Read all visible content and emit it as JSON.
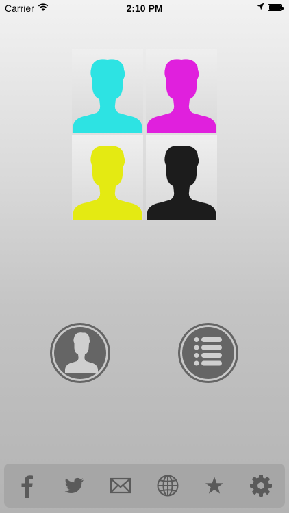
{
  "status_bar": {
    "carrier": "Carrier",
    "time": "2:10 PM",
    "wifi_icon": "wifi-icon",
    "location_icon": "location-arrow-icon",
    "battery_icon": "battery-icon",
    "battery_level": 1.0
  },
  "photo_grid": {
    "tiles": [
      {
        "name": "cyan-silhouette",
        "color": "#2de3e3"
      },
      {
        "name": "magenta-silhouette",
        "color": "#e020dd"
      },
      {
        "name": "yellow-silhouette",
        "color": "#e4ea12"
      },
      {
        "name": "black-silhouette",
        "color": "#1c1c1c"
      }
    ]
  },
  "actions": {
    "profile_button_icon": "person-icon",
    "list_button_icon": "list-icon"
  },
  "toolbar": {
    "items": [
      {
        "icon": "facebook-icon"
      },
      {
        "icon": "twitter-icon"
      },
      {
        "icon": "mail-icon"
      },
      {
        "icon": "globe-icon"
      },
      {
        "icon": "star-icon"
      },
      {
        "icon": "gear-icon"
      }
    ],
    "icon_color": "#5a5a5a"
  }
}
